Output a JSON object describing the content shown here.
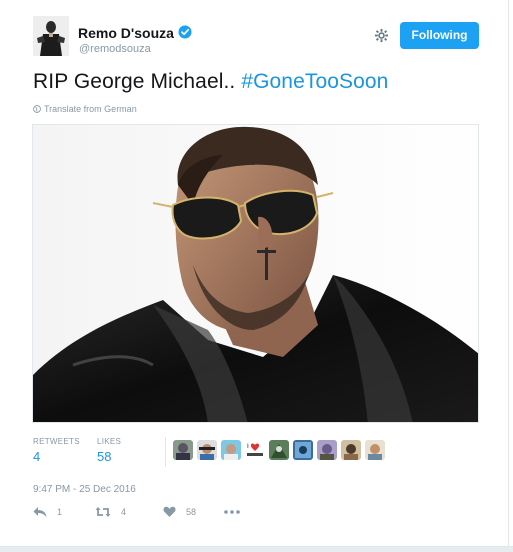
{
  "user": {
    "name": "Remo D'souza",
    "handle": "@remodsouza",
    "verified": true
  },
  "follow_button": {
    "label": "Following"
  },
  "tweet": {
    "text": "RIP George Michael.. ",
    "hashtag": "#GoneTooSoon",
    "translate_label": "Translate from German"
  },
  "stats": {
    "retweets_label": "RETWEETS",
    "retweets_value": "4",
    "likes_label": "LIKES",
    "likes_value": "58"
  },
  "timestamp": "9:47 PM - 25 Dec 2016",
  "actions": {
    "reply_count": "1",
    "retweet_count": "4",
    "like_count": "58",
    "more_icon": "more-icon"
  },
  "colors": {
    "accent": "#1da1f2",
    "link": "#1b95e0",
    "muted": "#8899a6"
  }
}
